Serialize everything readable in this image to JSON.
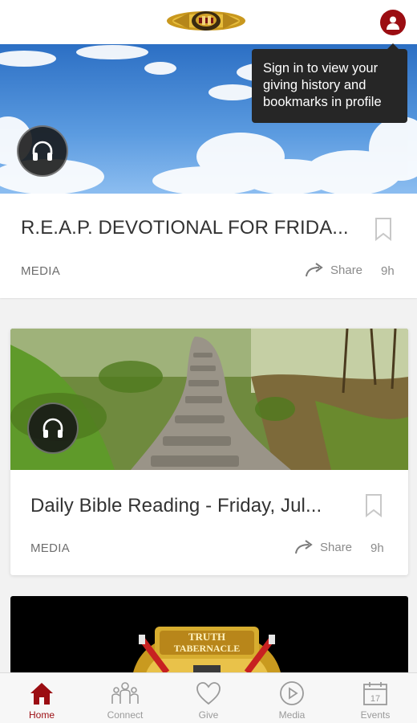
{
  "tooltip": {
    "text": "Sign in to view your giving history and bookmarks in profile"
  },
  "feed": {
    "items": [
      {
        "title": "R.E.A.P. DEVOTIONAL FOR FRIDA...",
        "type": "MEDIA",
        "share": "Share",
        "age": "9h"
      },
      {
        "title": "Daily Bible Reading - Friday, Jul...",
        "type": "MEDIA",
        "share": "Share",
        "age": "9h"
      }
    ],
    "third_logo": {
      "line1": "TRUTH",
      "line2": "TABERNACLE"
    }
  },
  "tabbar": {
    "tabs": [
      {
        "label": "Home",
        "icon": "home-icon",
        "active": true
      },
      {
        "label": "Connect",
        "icon": "people-icon",
        "active": false
      },
      {
        "label": "Give",
        "icon": "heart-icon",
        "active": false
      },
      {
        "label": "Media",
        "icon": "play-circle-icon",
        "active": false
      },
      {
        "label": "Events",
        "icon": "calendar-icon",
        "active": false
      }
    ],
    "events_day": "17"
  },
  "colors": {
    "accent": "#9b0d12",
    "tooltip_bg": "#262626",
    "card_bg": "#ffffff",
    "page_bg": "#f2f2f2"
  }
}
